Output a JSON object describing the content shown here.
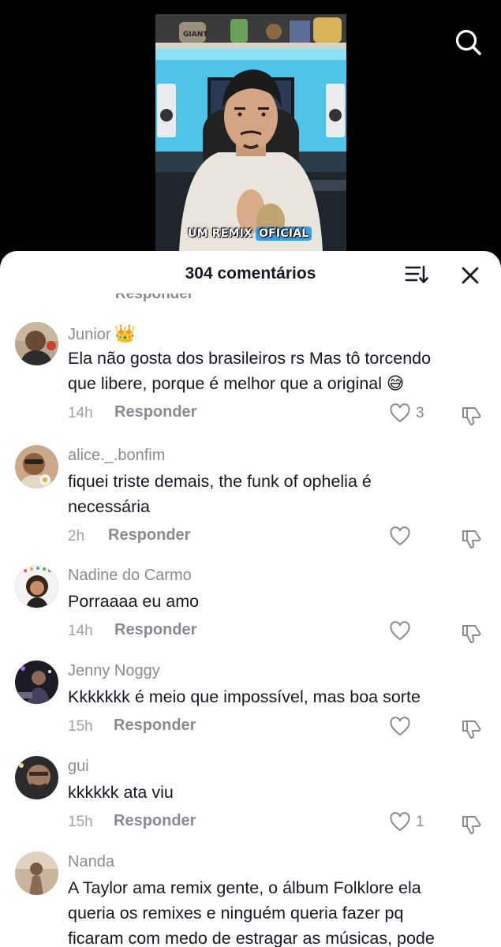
{
  "video": {
    "caption_part1": "UM REMIX",
    "caption_part2": "OFICIAL",
    "shelf_label": "GIANT",
    "search_icon": "search-icon"
  },
  "sheet": {
    "title": "304 comentários",
    "sort_icon": "sort-icon",
    "close_icon": "close-icon",
    "previous_reply_fragment": "Responder"
  },
  "comments": [
    {
      "username": "Junior",
      "badge": "👑",
      "text_line1": "Ela não gosta dos brasileiros rs Mas tô torcendo",
      "text_line2": "que libere, porque é melhor que a original 😅",
      "time": "14h",
      "reply_label": "Responder",
      "likes": "3",
      "avatar_color": "#7a5a40"
    },
    {
      "username": "alice._.bonfim",
      "text_line1": "fiquei triste demais, the funk of ophelia é",
      "text_line2": "necessária",
      "time": "2h",
      "reply_label": "Responder",
      "likes": "",
      "avatar_color": "#a37b5c"
    },
    {
      "username": "Nadine do Carmo",
      "text_line1": "Porraaaa eu amo",
      "time": "14h",
      "reply_label": "Responder",
      "likes": "",
      "avatar_color": "#f3f0ee"
    },
    {
      "username": "Jenny Noggy",
      "text_line1": "Kkkkkkk é meio que impossível, mas boa sorte",
      "time": "15h",
      "reply_label": "Responder",
      "likes": "",
      "avatar_color": "#2a2a35"
    },
    {
      "username": "gui",
      "text_line1": "kkkkkk ata viu",
      "time": "15h",
      "reply_label": "Responder",
      "likes": "1",
      "avatar_color": "#3b3530"
    },
    {
      "username": "Nanda",
      "text_line1": "A Taylor ama remix gente, o álbum Folklore ela",
      "text_line2": "queria os remixes e ninguém queria fazer pq",
      "text_line3": "ficaram com medo de estragar as músicas, pode",
      "avatar_color": "#b49a80"
    }
  ],
  "colors": {
    "sheet_bg": "#ffffff",
    "text_primary": "#161823",
    "text_secondary": "#8a8b91",
    "accent_blue": "#3aa0e8"
  }
}
